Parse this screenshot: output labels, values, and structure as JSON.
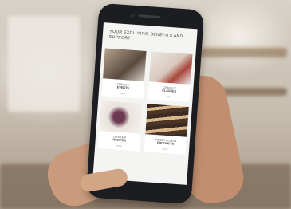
{
  "heading": "YOUR EXCLUSIVE BENEFITS AND SUPPORT",
  "tiles": [
    {
      "line1": "CERCLE V",
      "line2": "EVENTS",
      "more": "VIEW"
    },
    {
      "line1": "CERCLE V",
      "line2": "CLASSES",
      "more": "VIEW"
    },
    {
      "line1": "CERCLE V",
      "line2": "RECIPES",
      "more": "VIEW"
    },
    {
      "line1": "INSIDER ACCESS",
      "line2": "PRODUCTS",
      "more": "VIEW"
    }
  ]
}
